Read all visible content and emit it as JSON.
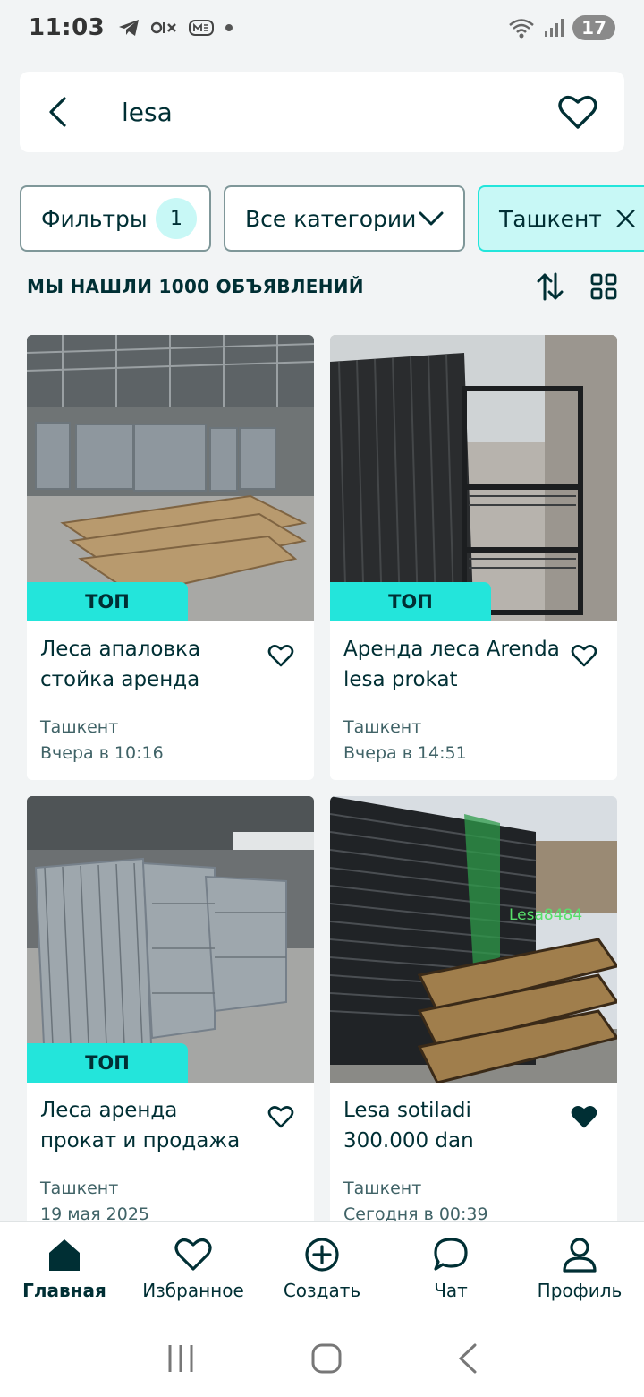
{
  "status_bar": {
    "time": "11:03",
    "icons_left": [
      "telegram-icon",
      "olx-icon",
      "me-icon",
      "dot-icon"
    ],
    "icons_right": [
      "wifi-icon",
      "signal-icon"
    ],
    "battery": "17"
  },
  "search": {
    "query": "lesa"
  },
  "filters": {
    "filters_label": "Фильтры",
    "filters_count": "1",
    "category_label": "Все категории",
    "city_label": "Ташкент"
  },
  "results": {
    "count_text": "МЫ НАШЛИ 1000 ОБЪЯВЛЕНИЙ"
  },
  "listings": [
    {
      "title": "Леса апаловка стойка аренда",
      "location": "Ташкент",
      "date": "Вчера в 10:16",
      "badge": "ТОП",
      "favorited": false
    },
    {
      "title": "Аренда леса Arenda lesa prokat",
      "location": "Ташкент",
      "date": "Вчера в 14:51",
      "badge": "ТОП",
      "favorited": false
    },
    {
      "title": "Леса аренда прокат и продажа",
      "location": "Ташкент",
      "date": "19 мая 2025",
      "badge": "ТОП",
      "favorited": false
    },
    {
      "title": "Lesa sotiladi 300.000 dan",
      "location": "Ташкент",
      "date": "Сегодня в 00:39",
      "badge": "",
      "favorited": true,
      "watermark": "Lesa8484"
    }
  ],
  "bottom_nav": {
    "items": [
      {
        "label": "Главная",
        "icon": "home-icon",
        "active": true
      },
      {
        "label": "Избранное",
        "icon": "heart-icon",
        "active": false
      },
      {
        "label": "Создать",
        "icon": "plus-circle-icon",
        "active": false
      },
      {
        "label": "Чат",
        "icon": "chat-icon",
        "active": false
      },
      {
        "label": "Профиль",
        "icon": "profile-icon",
        "active": false
      }
    ]
  },
  "colors": {
    "accent": "#23e5db",
    "accent_light": "#c8f8f6",
    "text": "#002f34",
    "background": "#f2f4f5"
  }
}
